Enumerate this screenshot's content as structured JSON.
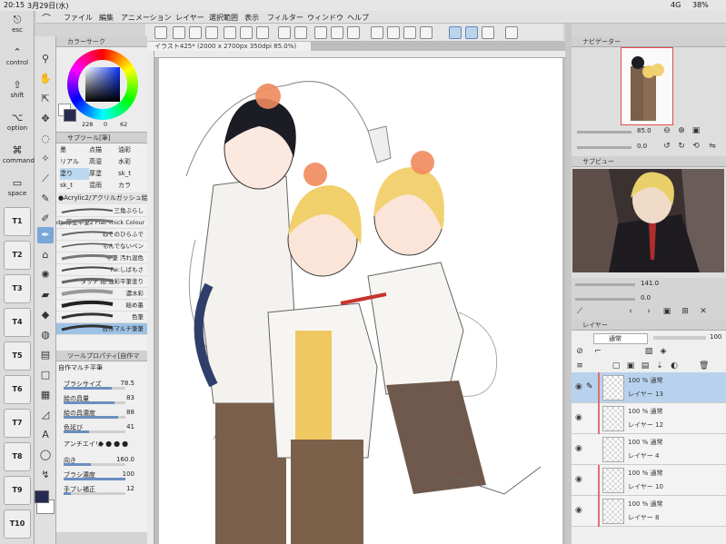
{
  "status": {
    "time": "20:15",
    "date": "3月29日(水)",
    "signal": "4G",
    "battery": "38%"
  },
  "menu": {
    "items": [
      "ファイル",
      "編集",
      "アニメーション",
      "レイヤー",
      "選択範囲",
      "表示",
      "フィルター",
      "ウィンドウ",
      "ヘルプ"
    ]
  },
  "modifiers": [
    "esc",
    "control",
    "shift",
    "option",
    "command",
    "space"
  ],
  "quick_keys": [
    "T1",
    "T2",
    "T3",
    "T4",
    "T5",
    "T6",
    "T7",
    "T8",
    "T9",
    "T10"
  ],
  "color_panel": {
    "title": "カラーサーク",
    "h": "228",
    "s": "0",
    "v": "62",
    "main_color": "#272b52"
  },
  "subtool": {
    "title": "サブツール[筆]",
    "grid": [
      "墨",
      "点描",
      "油彩",
      "リアル",
      "高湿",
      "水彩",
      "塗り",
      "厚塗",
      "sk_t",
      "sk_t",
      "混雨",
      "カラ"
    ],
    "group": "●Acrylic2/アクリルガッシュ絵筆",
    "brushes": [
      "三角ぶらし",
      "dp-厚塗平筆2 Flat Thick Colour",
      "ねそのひらふで",
      "もんでないペン",
      "平筆 汚れ混色",
      "Re:しばもさ",
      "タッチ 拍 油彩平筆塗り",
      "濃水彩",
      "絵め墨",
      "色筆",
      "自作マルチ筆筆"
    ]
  },
  "tool_property": {
    "title": "ツールプロパティ[自作マ",
    "name": "自作マルチ平筆",
    "rows": [
      {
        "label": "ブラシサイズ",
        "value": "78.5",
        "pct": 0.78
      },
      {
        "label": "絵の具量",
        "value": "83",
        "pct": 0.83
      },
      {
        "label": "絵の具濃度",
        "value": "88",
        "pct": 0.88
      },
      {
        "label": "色延び",
        "value": "41",
        "pct": 0.41
      },
      {
        "label": "アンチエイリ",
        "value": "",
        "pct": 0
      },
      {
        "label": "向き",
        "value": "160.0",
        "pct": 0.44
      },
      {
        "label": "ブラシ濃度",
        "value": "100",
        "pct": 1.0
      },
      {
        "label": "手ブレ補正",
        "value": "12",
        "pct": 0.12
      }
    ]
  },
  "canvas": {
    "tab": "イラスト425* (2000 x 2700px 350dpi 85.0%)"
  },
  "navigator": {
    "title": "ナビゲーター",
    "zoom": "85.0",
    "angle": "0.0"
  },
  "subview": {
    "title": "サブビュー",
    "zoom": "141.0",
    "angle": "0.0"
  },
  "layers": {
    "title": "レイヤー",
    "blend_mode": "通常",
    "opacity": "100",
    "items": [
      {
        "opacity": "100 % 通常",
        "name": "レイヤー 13",
        "selected": true
      },
      {
        "opacity": "100 % 通常",
        "name": "レイヤー 12",
        "selected": false
      },
      {
        "opacity": "100 % 通常",
        "name": "レイヤー 4",
        "selected": false
      },
      {
        "opacity": "100 % 通常",
        "name": "レイヤー 10",
        "selected": false
      },
      {
        "opacity": "100 % 通常",
        "name": "レイヤー 8",
        "selected": false
      }
    ]
  },
  "colors": {
    "accent": "#5a8ac0",
    "selection": "#b8d2ee",
    "layer_mark": "#e07070"
  }
}
